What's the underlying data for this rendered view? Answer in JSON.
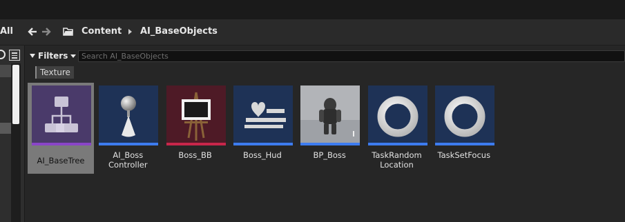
{
  "nav": {
    "all_label": "All",
    "crumbs": [
      "Content",
      "AI_BaseObjects"
    ]
  },
  "filters": {
    "label": "Filters",
    "search_placeholder": "Search AI_BaseObjects",
    "chip": "Texture"
  },
  "assets": [
    {
      "name": "AI_BaseTree",
      "lines": [
        "AI_BaseTree"
      ],
      "bar_color": "#8a45c8",
      "bg": "#4a3a6a",
      "icon": "behavior-tree-icon",
      "selected": true
    },
    {
      "name": "AI_Boss Controller",
      "lines": [
        "AI_Boss",
        "Controller"
      ],
      "bar_color": "#3d7cf0",
      "bg": "#1e3256",
      "icon": "ai-controller-icon",
      "selected": false
    },
    {
      "name": "Boss_BB",
      "lines": [
        "Boss_BB"
      ],
      "bar_color": "#c8264a",
      "bg": "#4e1a26",
      "icon": "blackboard-icon",
      "selected": false
    },
    {
      "name": "Boss_Hud",
      "lines": [
        "Boss_Hud"
      ],
      "bar_color": "#3d7cf0",
      "bg": "#1e3256",
      "icon": "widget-blueprint-icon",
      "selected": false
    },
    {
      "name": "BP_Boss",
      "lines": [
        "BP_Boss"
      ],
      "bar_color": "#3d7cf0",
      "bg": "#8e9094",
      "icon": "character-preview-icon",
      "selected": false
    },
    {
      "name": "TaskRandom Location",
      "lines": [
        "TaskRandom",
        "Location"
      ],
      "bar_color": "#3d7cf0",
      "bg": "#1e3256",
      "icon": "task-ring-icon",
      "selected": false
    },
    {
      "name": "TaskSetFocus",
      "lines": [
        "TaskSetFocus"
      ],
      "bar_color": "#3d7cf0",
      "bg": "#1e3256",
      "icon": "task-ring-icon",
      "selected": false
    }
  ]
}
